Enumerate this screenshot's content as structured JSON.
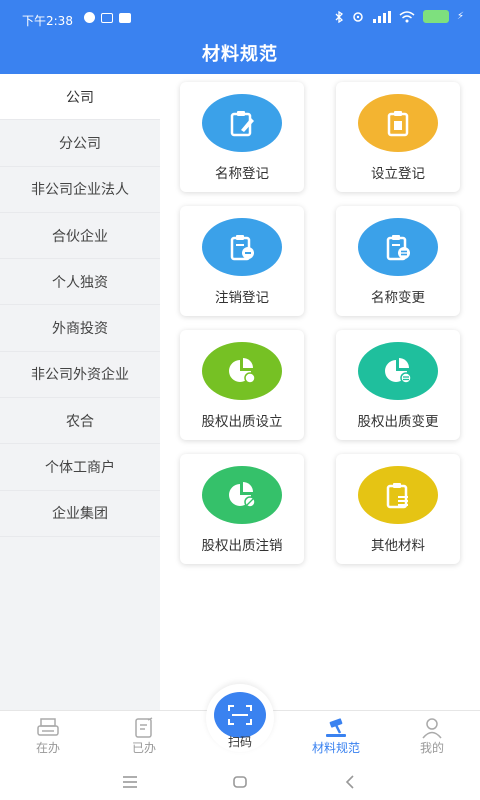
{
  "status": {
    "time": "下午2:38"
  },
  "header": {
    "title": "材料规范"
  },
  "sidebar": {
    "items": [
      {
        "label": "公司",
        "active": true
      },
      {
        "label": "分公司"
      },
      {
        "label": "非公司企业法人"
      },
      {
        "label": "合伙企业"
      },
      {
        "label": "个人独资"
      },
      {
        "label": "外商投资"
      },
      {
        "label": "非公司外资企业"
      },
      {
        "label": "农合"
      },
      {
        "label": "个体工商户"
      },
      {
        "label": "企业集团"
      }
    ]
  },
  "cards": [
    {
      "label": "名称登记",
      "color": "#3ba1e9",
      "icon": "clipboard-edit-icon"
    },
    {
      "label": "设立登记",
      "color": "#f3b431",
      "icon": "clipboard-icon"
    },
    {
      "label": "注销登记",
      "color": "#3ba1e9",
      "icon": "clipboard-cancel-icon"
    },
    {
      "label": "名称变更",
      "color": "#3ba1e9",
      "icon": "clipboard-change-icon"
    },
    {
      "label": "股权出质设立",
      "color": "#76c124",
      "icon": "pie-chart-icon"
    },
    {
      "label": "股权出质变更",
      "color": "#1fbf9d",
      "icon": "pie-chart-change-icon"
    },
    {
      "label": "股权出质注销",
      "color": "#35c16a",
      "icon": "pie-chart-cancel-icon"
    },
    {
      "label": "其他材料",
      "color": "#e5c414",
      "icon": "clipboard-list-icon"
    }
  ],
  "tabbar": {
    "items": [
      {
        "label": "在办",
        "icon": "printer-icon"
      },
      {
        "label": "已办",
        "icon": "document-check-icon"
      },
      {
        "label": "扫码",
        "icon": "scan-icon"
      },
      {
        "label": "材料规范",
        "icon": "gavel-icon",
        "active": true
      },
      {
        "label": "我的",
        "icon": "user-icon"
      }
    ]
  },
  "colors": {
    "primary": "#3a82f0",
    "sidebar_bg": "#f2f3f5"
  }
}
